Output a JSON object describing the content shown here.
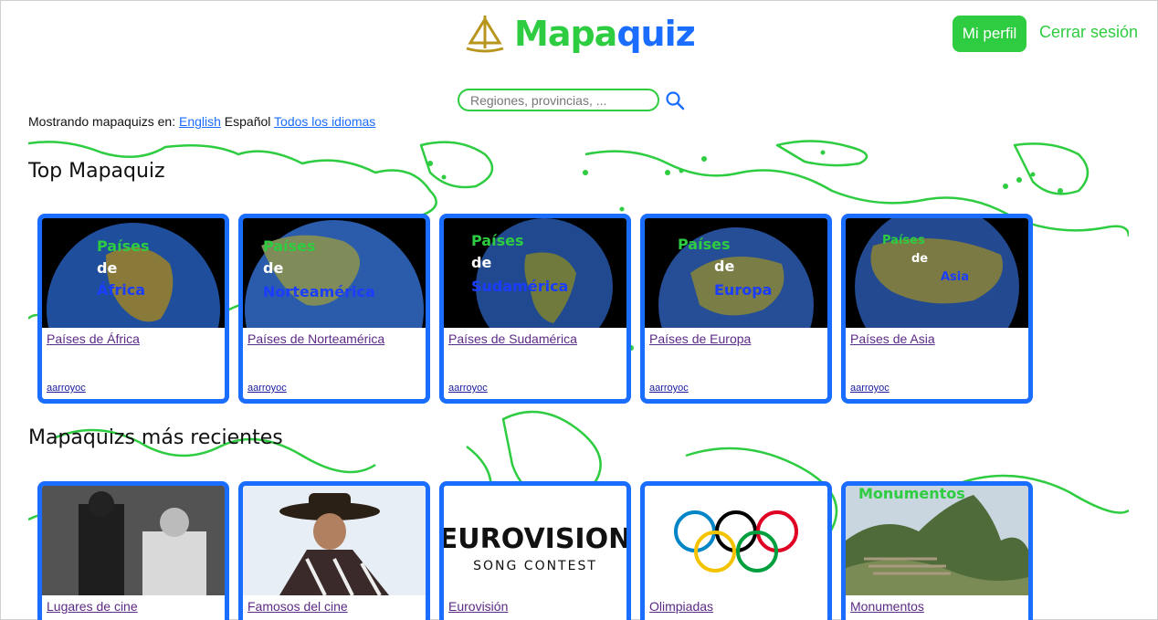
{
  "header": {
    "logo_part1": "Mapa",
    "logo_part2": "quiz",
    "profile_button": "Mi perfil",
    "logout_link": "Cerrar sesión"
  },
  "search": {
    "placeholder": "Regiones, provincias, ..."
  },
  "languages": {
    "prefix": "Mostrando mapaquizs en:",
    "english": "English",
    "spanish": "Español",
    "all": "Todos los idiomas"
  },
  "sections": {
    "top_title": "Top Mapaquiz",
    "recent_title": "Mapaquizs más recientes"
  },
  "top_cards": [
    {
      "title": "Países de África",
      "author": "aarroyoc",
      "l1": "Países",
      "l2": "de",
      "l3": "África"
    },
    {
      "title": "Países de Norteamérica",
      "author": "aarroyoc",
      "l1": "Países",
      "l2": "de",
      "l3": "Norteamérica"
    },
    {
      "title": "Países de Sudamérica",
      "author": "aarroyoc",
      "l1": "Países",
      "l2": "de",
      "l3": "Sudamérica"
    },
    {
      "title": "Países de Europa",
      "author": "aarroyoc",
      "l1": "Países",
      "l2": "de",
      "l3": "Europa"
    },
    {
      "title": "Países de Asia",
      "author": "aarroyoc",
      "l1": "Países",
      "l2": "de",
      "l3": "Asia"
    }
  ],
  "recent_cards": [
    {
      "title": "Lugares de cine"
    },
    {
      "title": "Famosos del cine"
    },
    {
      "title": "Eurovisión",
      "logo_line1": "EUROVISION",
      "logo_line2": "SONG CONTEST"
    },
    {
      "title": "Olimpiadas"
    },
    {
      "title": "Monumentos",
      "overlay": "Monumentos"
    }
  ],
  "colors": {
    "green": "#2ecc40",
    "blue": "#1a6dff"
  }
}
